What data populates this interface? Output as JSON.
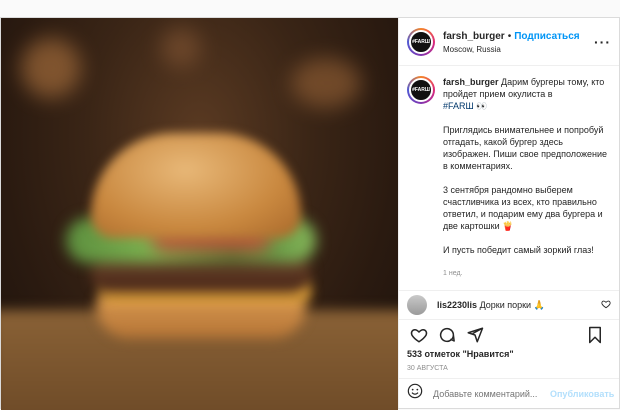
{
  "header": {
    "username": "farsh_burger",
    "dot": "•",
    "follow_label": "Подписаться",
    "location": "Moscow, Russia",
    "more_icon": "more-horizontal-icon",
    "avatar_text": "#FARШ"
  },
  "caption": {
    "username": "farsh_burger",
    "lead": "Дарим бургеры тому, кто пройдет прием окулиста в",
    "hashtag": "#FARШ",
    "emoji": "👀",
    "p2": "Приглядись внимательнее и попробуй отгадать, какой бургер здесь изображен. Пиши свое предположение в комментариях.",
    "p3": "3 сентября рандомно выберем счастливчика из всех, кто правильно ответил, и подарим ему два бургера и две картошки",
    "p3_emoji": "🍟",
    "p4": "И пусть победит самый зоркий глаз!",
    "time": "1 нед."
  },
  "comment": {
    "username": "lis2230lis",
    "text": "Дорки порки",
    "emoji": "🙏"
  },
  "actions": {
    "like_icon": "heart-icon",
    "comment_icon": "comment-icon",
    "share_icon": "share-icon",
    "save_icon": "bookmark-icon"
  },
  "likes": "533 отметок \"Нравится\"",
  "date": "30 АВГУСТА",
  "add_comment": {
    "placeholder": "Добавьте комментарий...",
    "publish_label": "Опубликовать",
    "emoji_icon": "smiley-icon"
  },
  "colors": {
    "accent": "#0095f6",
    "publish_disabled": "#b2dffc",
    "muted": "#8e8e8e"
  }
}
